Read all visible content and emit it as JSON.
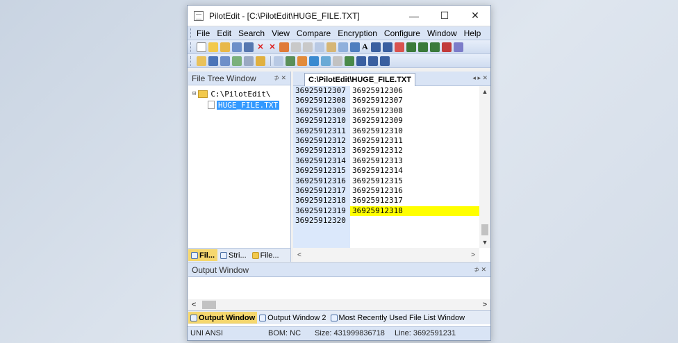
{
  "window": {
    "title": "PilotEdit - [C:\\PilotEdit\\HUGE_FILE.TXT]",
    "minimize": "—",
    "maximize": "☐",
    "close": "✕"
  },
  "menu": [
    "File",
    "Edit",
    "Search",
    "View",
    "Compare",
    "Encryption",
    "Configure",
    "Window",
    "Help"
  ],
  "toolbar": {
    "font_glyph": "A"
  },
  "file_tree": {
    "title": "File Tree Window",
    "pin": "⊅ ✕",
    "folder": "C:\\PilotEdit\\",
    "file": "HUGE_FILE.TXT",
    "tabs": [
      "Fil...",
      "Stri...",
      "File..."
    ]
  },
  "editor": {
    "tab_label": "C:\\PilotEdit\\HUGE_FILE.TXT",
    "tab_controls": "◂ ▸ ✕",
    "col_a": [
      "36925912307",
      "36925912308",
      "36925912309",
      "36925912310",
      "36925912311",
      "36925912312",
      "36925912313",
      "36925912314",
      "36925912315",
      "36925912316",
      "36925912317",
      "36925912318",
      "36925912319",
      "36925912320"
    ],
    "col_b": [
      "36925912306",
      "36925912307",
      "36925912308",
      "36925912309",
      "36925912310",
      "36925912311",
      "36925912312",
      "36925912313",
      "36925912314",
      "36925912315",
      "36925912316",
      "36925912317",
      "36925912318"
    ],
    "highlight_color": "#ffff00"
  },
  "output": {
    "title": "Output Window",
    "pin": "⊅ ✕",
    "tabs": [
      "Output Window",
      "Output Window 2",
      "Most Recently Used File List Window"
    ]
  },
  "status": {
    "encoding": "UNI ANSI",
    "bom": "BOM: NC",
    "size": "Size: 431999836718",
    "line": "Line: 3692591231"
  }
}
